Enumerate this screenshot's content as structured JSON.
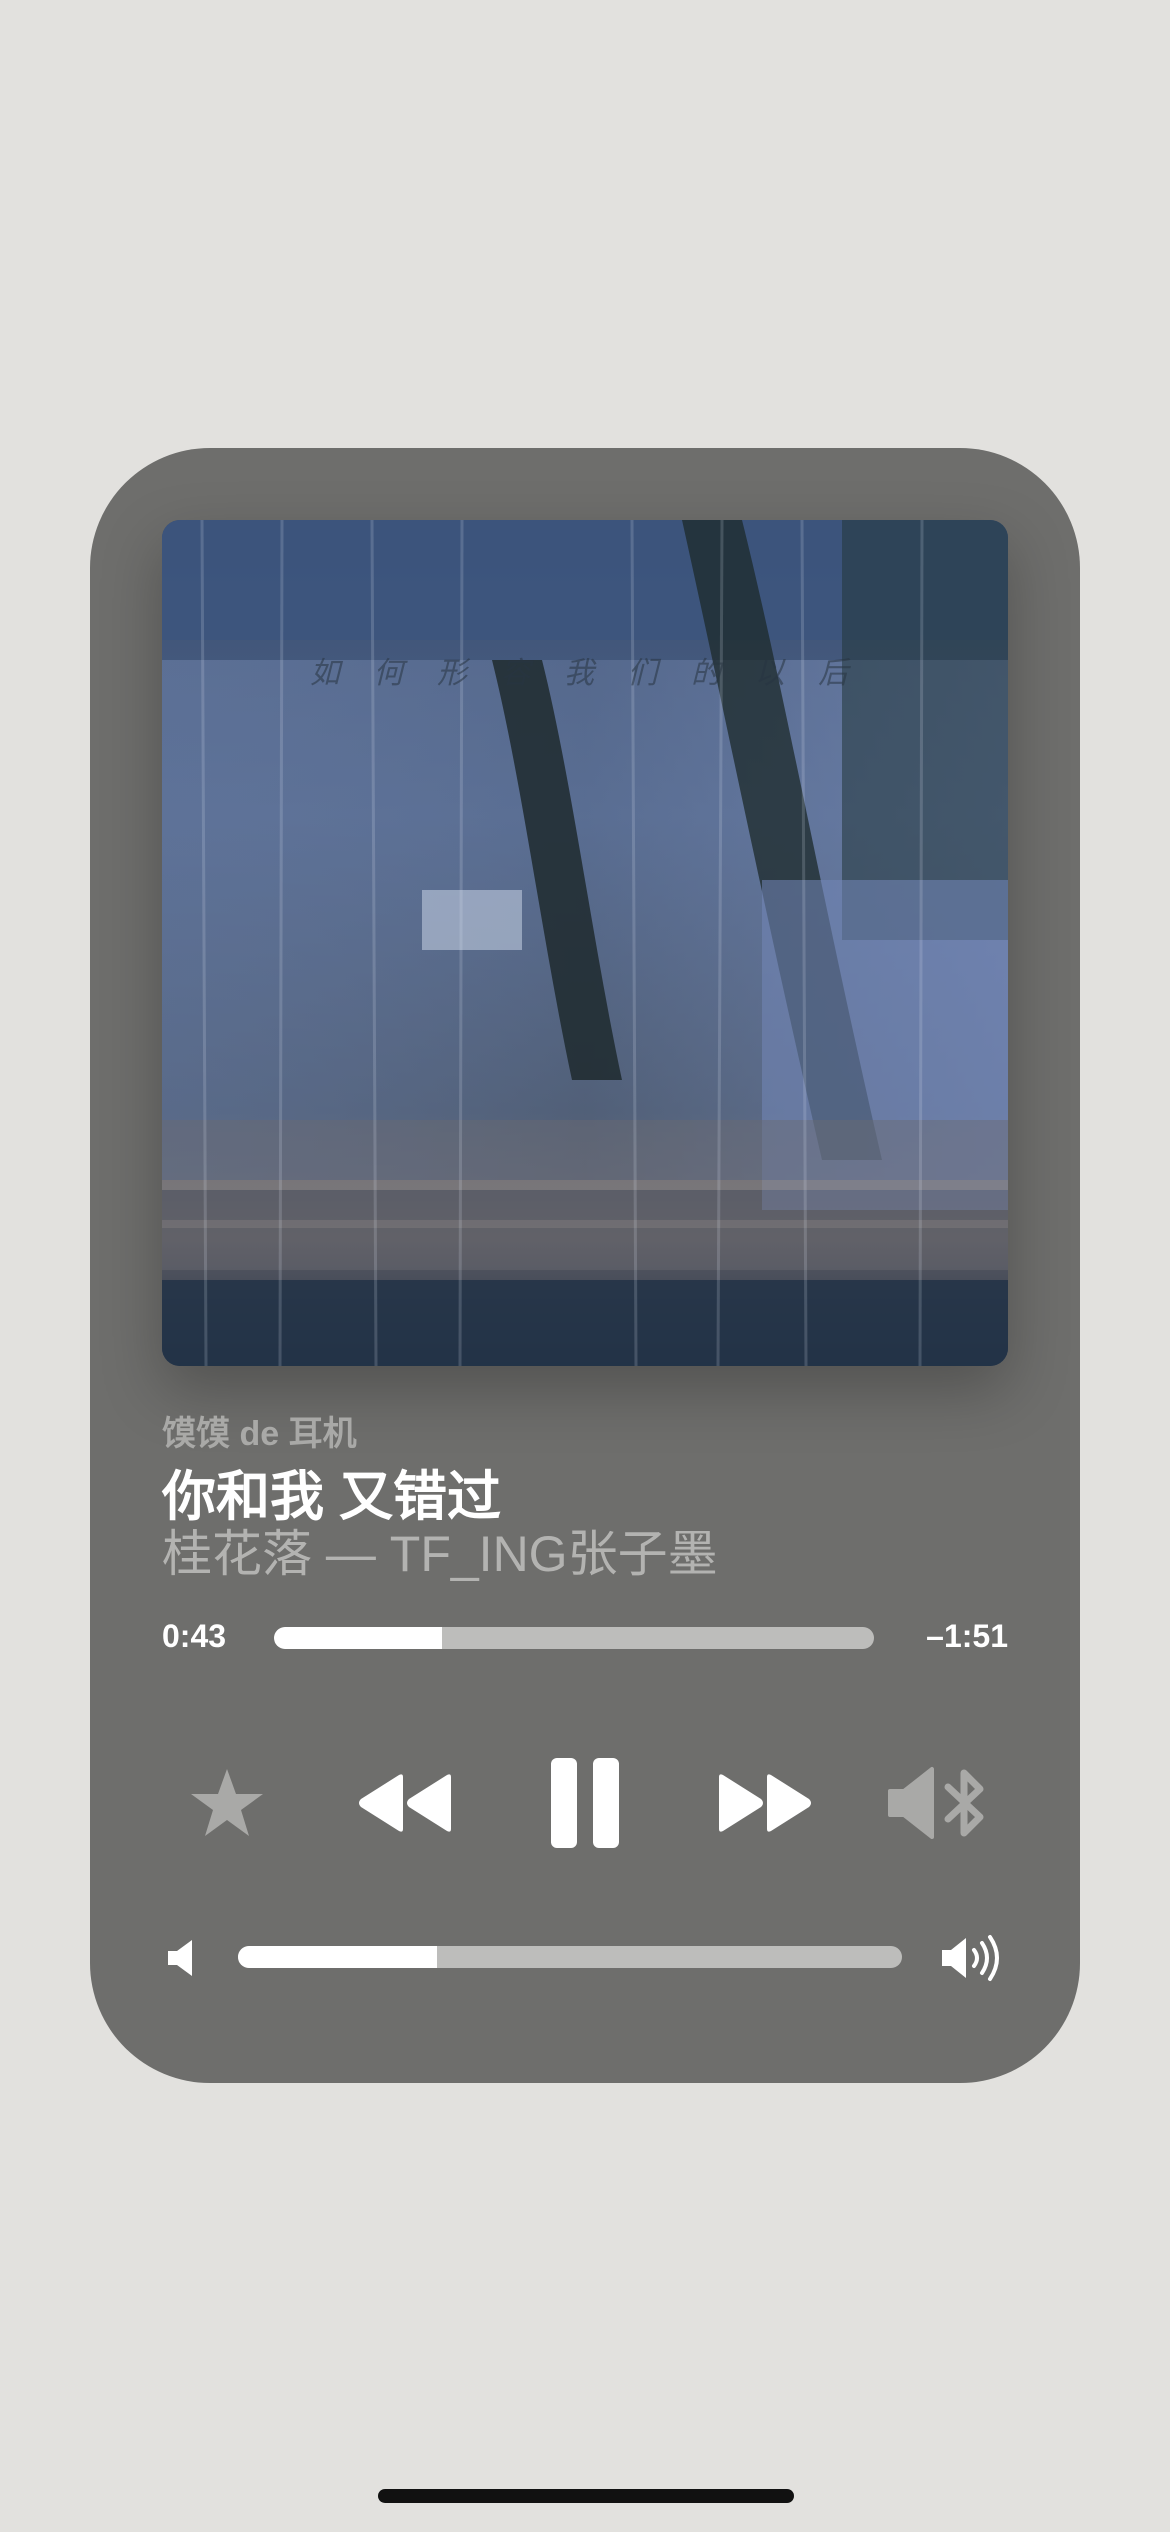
{
  "player": {
    "artwork_caption": "如 何 形 容 我 们 的 以 后",
    "device": "馍馍 de 耳机",
    "title": "你和我 又错过",
    "artist": "桂花落 — TF_ING张子墨",
    "elapsed": "0:43",
    "remaining": "–1:51",
    "progress_fraction": 0.28,
    "volume_fraction": 0.3
  },
  "icons": {
    "favorite": "star-icon",
    "previous": "rewind-icon",
    "play_pause": "pause-icon",
    "next": "fast-forward-icon",
    "output": "bluetooth-speaker-icon",
    "volume_low": "speaker-low-icon",
    "volume_high": "speaker-high-icon"
  },
  "colors": {
    "background": "#e2e1de",
    "card": "#6e6e6c",
    "accent": "#ffffff",
    "track": "#bdbdbb",
    "icon_muted": "#a9a9a7"
  }
}
